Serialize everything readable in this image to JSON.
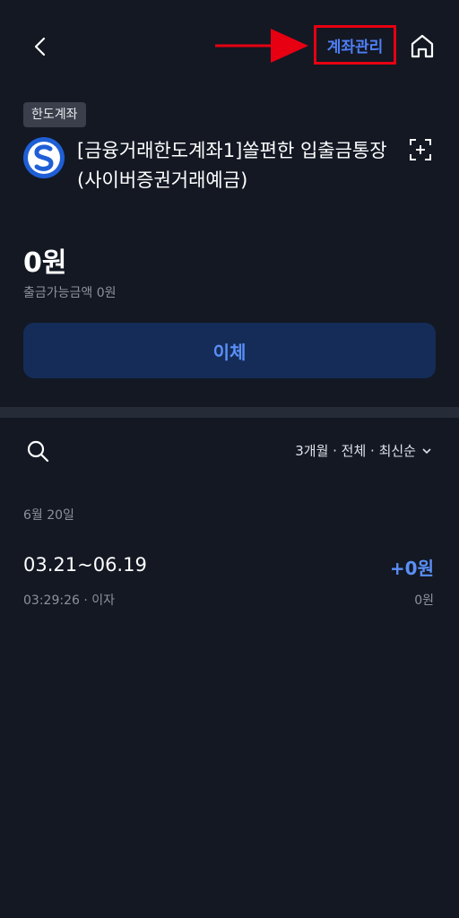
{
  "header": {
    "manage_label": "계좌관리"
  },
  "account": {
    "badge": "한도계좌",
    "name_line1": "[금융거래한도계좌1]쏠편한 입출금통장",
    "name_line2": "(사이버증권거래예금)",
    "balance": "0원",
    "available": "출금가능금액 0원"
  },
  "actions": {
    "transfer_label": "이체"
  },
  "filter": {
    "label": "3개월 · 전체 · 최신순"
  },
  "transactions": [
    {
      "date_group": "6월 20일",
      "title": "03.21~06.19",
      "amount": "+0원",
      "meta": "03:29:26 · 이자",
      "balance": "0원"
    }
  ],
  "colors": {
    "background": "#131823",
    "accent": "#5b8ff7",
    "button_bg": "#142c57",
    "highlight_red": "#e60012"
  },
  "icons": [
    "back-icon",
    "arrow-icon",
    "home-icon",
    "bank-logo-icon",
    "scan-icon",
    "search-icon",
    "chevron-down-icon"
  ]
}
